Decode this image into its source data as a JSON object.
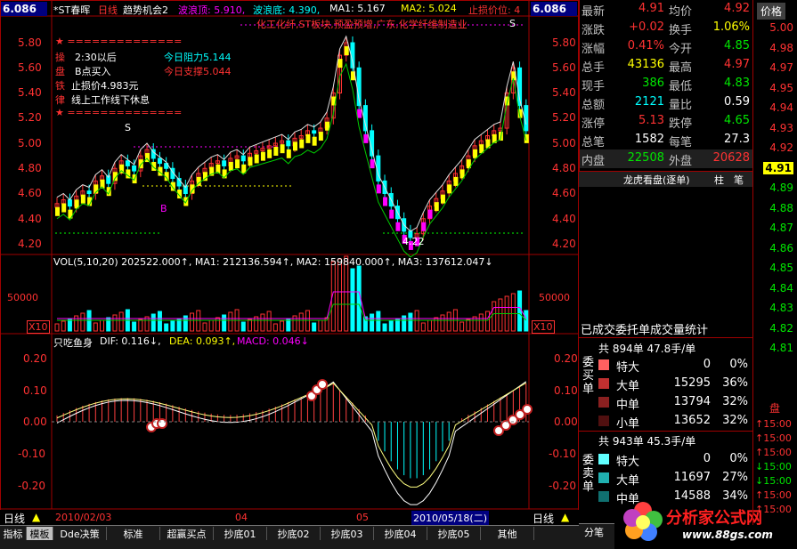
{
  "header": {
    "price_top_left": "6.086",
    "price_top_right": "6.086",
    "stock_name": "*ST春晖",
    "period": "日线",
    "template": "趋势机会2",
    "wave_top_label": "波浪顶: 5.910,",
    "wave_bottom_label": "波浪底: 4.390,",
    "ma1_label": "MA1: 5.167",
    "ma2_label": "MA2: 5.024",
    "stop_label": "止损价位: 4",
    "sector_text": "化工化纤,ST板块,预盈预增,广东,化学纤维制造业"
  },
  "signal_box": {
    "stars_top": "★ ==============",
    "line1_tag": "操",
    "line1": "2:30以后",
    "line2_tag": "盘",
    "line2": "B点买入",
    "line3_tag": "铁",
    "line3": "止损价4.983元",
    "line4_tag": "律",
    "line4": "线上工作线下休息",
    "stars_bottom": "★ ==============",
    "resistance": "今日阻力5.144",
    "support": "今日支撑5.044"
  },
  "price_axis_left": [
    "5.80",
    "5.60",
    "5.40",
    "5.20",
    "5.00",
    "4.80",
    "4.60",
    "4.40",
    "4.20"
  ],
  "price_axis_right": [
    "5.80",
    "5.60",
    "5.40",
    "5.20",
    "5.00",
    "4.80",
    "4.60",
    "4.40",
    "4.20"
  ],
  "chart_marks": {
    "s_label_left": "S",
    "s_label_right": "S",
    "b_label": "B",
    "low_label": "4.22"
  },
  "volume": {
    "header": "VOL(5,10,20)  202522.000↑, MA1: 212136.594↑, MA2: 159840.000↑, MA3: 137612.047↓",
    "axis_50000": "50000",
    "axis_x10": "X10"
  },
  "macd": {
    "title": "只吃鱼身",
    "dif": "DIF: 0.116↓,",
    "dea": "DEA: 0.093↑,",
    "macd_val": "MACD: 0.046↓",
    "axis": [
      "0.20",
      "0.10",
      "0.00",
      "-0.10",
      "-0.20"
    ]
  },
  "date_bar": {
    "period_left": "日线",
    "date_start": "2010/02/03",
    "month_04": "04",
    "month_05": "05",
    "date_current": "2010/05/18(二)",
    "period_right": "日线"
  },
  "tabs": [
    "指标",
    "模板",
    "Dde决策",
    "标准",
    "超赢买点",
    "抄底01",
    "抄底02",
    "抄底03",
    "抄底04",
    "抄底05",
    "其他"
  ],
  "quote": {
    "rows": [
      {
        "l1": "最新",
        "v1": "4.91",
        "c1": "red",
        "l2": "均价",
        "v2": "4.92",
        "c2": "red"
      },
      {
        "l1": "涨跌",
        "v1": "+0.02",
        "c1": "red",
        "l2": "换手",
        "v2": "1.06%",
        "c2": "yellow"
      },
      {
        "l1": "涨幅",
        "v1": "0.41%",
        "c1": "red",
        "l2": "今开",
        "v2": "4.85",
        "c2": "green"
      },
      {
        "l1": "总手",
        "v1": "43136",
        "c1": "yellow",
        "l2": "最高",
        "v2": "4.97",
        "c2": "red"
      },
      {
        "l1": "现手",
        "v1": "386",
        "c1": "green",
        "l2": "最低",
        "v2": "4.83",
        "c2": "green"
      },
      {
        "l1": "总额",
        "v1": "2121",
        "c1": "cyan",
        "l2": "量比",
        "v2": "0.59",
        "c2": "white"
      },
      {
        "l1": "涨停",
        "v1": "5.13",
        "c1": "red",
        "l2": "跌停",
        "v2": "4.65",
        "c2": "green"
      },
      {
        "l1": "总笔",
        "v1": "1582",
        "c1": "white",
        "l2": "每笔",
        "v2": "27.3",
        "c2": "white"
      },
      {
        "l1": "内盘",
        "v1": "22508",
        "c1": "green",
        "l2": "外盘",
        "v2": "20628",
        "c2": "red"
      }
    ]
  },
  "dragon_tiger": {
    "title": "龙虎看盘(逐单)",
    "tab_zhu": "柱",
    "tab_bi": "笔",
    "caption": "已成交委托单成交量统计",
    "buy_header": "共 894单 47.8手/单",
    "buy_side": "委买单",
    "buy_rows": [
      {
        "label": "特大",
        "vol": "0",
        "pct": "0%",
        "color": "#ff6060"
      },
      {
        "label": "大单",
        "vol": "15295",
        "pct": "36%",
        "color": "#c03030"
      },
      {
        "label": "中单",
        "vol": "13794",
        "pct": "32%",
        "color": "#8a2020"
      },
      {
        "label": "小单",
        "vol": "13652",
        "pct": "32%",
        "color": "#501010"
      }
    ],
    "sell_header": "共 943单 45.3手/单",
    "sell_side": "委卖单",
    "sell_rows": [
      {
        "label": "特大",
        "vol": "0",
        "pct": "0%",
        "color": "#60ffff"
      },
      {
        "label": "大单",
        "vol": "11697",
        "pct": "27%",
        "color": "#20b0b0"
      },
      {
        "label": "中单",
        "vol": "14588",
        "pct": "34%",
        "color": "#107070"
      }
    ],
    "bottom_tab": "分笔",
    "watermark": "分析家公式网",
    "watermark_url": "www.88gs.com"
  },
  "price_ladder": {
    "header": "价格",
    "prices": [
      "5.00",
      "4.98",
      "4.97",
      "4.95",
      "4.94",
      "4.93",
      "4.92",
      "4.91",
      "4.89",
      "4.88",
      "4.87",
      "4.86",
      "4.85",
      "4.84",
      "4.83",
      "4.82",
      "4.81"
    ],
    "current": "4.91",
    "pan_label": "盘",
    "times": [
      "↑15:00",
      "↑15:00",
      "↑15:00",
      "↓15:00",
      "↓15:00",
      "↑15:00",
      "↑15:00"
    ]
  }
}
